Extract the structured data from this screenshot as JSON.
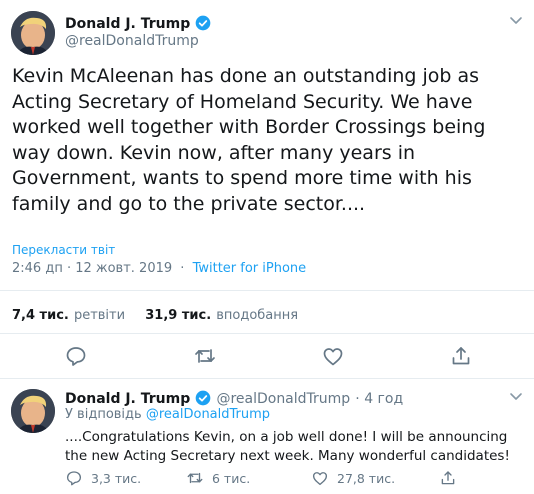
{
  "main_tweet": {
    "author_name": "Donald J. Trump",
    "author_handle": "@realDonaldTrump",
    "text": "Kevin McAleenan has done an outstanding job as Acting Secretary of Homeland Security. We have worked well together with Border Crossings being way down. Kevin now, after many years in Government, wants to spend more time with his family and go to the private sector....",
    "translate_label": "Перекласти твіт",
    "time": "2:46 дп · 12 жовт. 2019",
    "source": "Twitter for iPhone",
    "retweets_count": "7,4 тис.",
    "retweets_label": "ретвіти",
    "likes_count": "31,9 тис.",
    "likes_label": "вподобання",
    "icons": [
      "verified-icon",
      "chevron-down-icon",
      "reply-icon",
      "retweet-icon",
      "like-icon",
      "share-icon"
    ]
  },
  "reply_tweet": {
    "author_name": "Donald J. Trump",
    "author_handle": "@realDonaldTrump",
    "time_ago": "· 4 год",
    "replying_to_label": "У відповідь",
    "replying_to_handle": "@realDonaldTrump",
    "text": "....Congratulations Kevin, on a job well done! I will be announcing the new Acting Secretary next week. Many wonderful candidates!",
    "reply_count": "3,3 тис.",
    "retweet_count": "6 тис.",
    "like_count": "27,8 тис."
  },
  "colors": {
    "link": "#1da1f2",
    "muted": "#657786",
    "divider": "#e6ecf0",
    "verified": "#1da1f2"
  }
}
